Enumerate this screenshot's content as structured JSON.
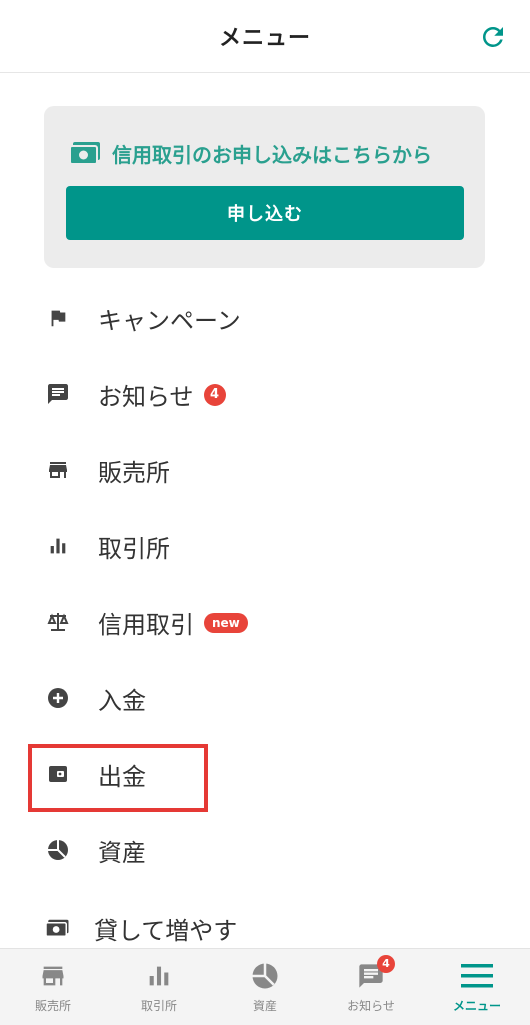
{
  "header": {
    "title": "メニュー",
    "refresh_icon": "refresh-icon"
  },
  "promo": {
    "text": "信用取引のお申し込みはこちらから",
    "icon": "cash-icon",
    "button_label": "申し込む",
    "accent": "#00958a"
  },
  "menu": {
    "items": [
      {
        "label": "キャンペーン",
        "icon": "flag-icon"
      },
      {
        "label": "お知らせ",
        "icon": "chat-icon",
        "badge": "4"
      },
      {
        "label": "販売所",
        "icon": "store-icon"
      },
      {
        "label": "取引所",
        "icon": "bar-chart-icon"
      },
      {
        "label": "信用取引",
        "icon": "scale-icon",
        "badge": "new"
      },
      {
        "label": "入金",
        "icon": "plus-circle-icon"
      },
      {
        "label": "出金",
        "icon": "wallet-icon",
        "highlighted": true
      },
      {
        "label": "資産",
        "icon": "pie-chart-icon"
      },
      {
        "label": "貸して増やす",
        "icon": "cash-icon"
      }
    ]
  },
  "tabbar": {
    "tabs": [
      {
        "label": "販売所",
        "icon": "store-icon"
      },
      {
        "label": "取引所",
        "icon": "bar-chart-icon"
      },
      {
        "label": "資産",
        "icon": "pie-chart-icon"
      },
      {
        "label": "お知らせ",
        "icon": "chat-icon",
        "badge": "4"
      },
      {
        "label": "メニュー",
        "icon": "menu-icon",
        "active": true
      }
    ]
  },
  "colors": {
    "brand": "#00958a",
    "badge": "#e8443a",
    "highlight": "#e53935"
  }
}
